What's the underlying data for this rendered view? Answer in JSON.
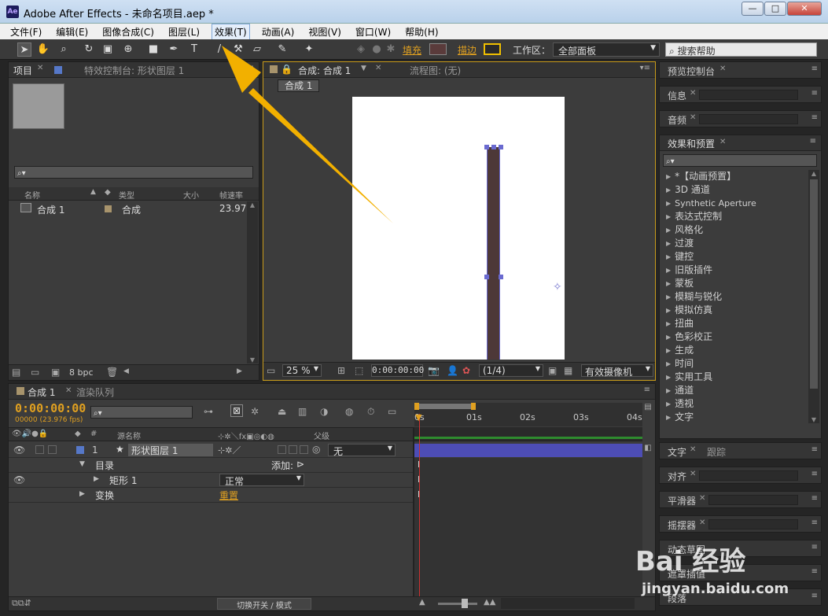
{
  "window": {
    "title": "Adobe After Effects - 未命名项目.aep *",
    "logo": "Ae",
    "min": "—",
    "max": "□",
    "close": "✕"
  },
  "menu": [
    "文件(F)",
    "编辑(E)",
    "图像合成(C)",
    "图层(L)",
    "效果(T)",
    "动画(A)",
    "视图(V)",
    "窗口(W)",
    "帮助(H)"
  ],
  "toolbar": {
    "fill_label": "填充",
    "stroke_label": "描边",
    "workspace_label": "工作区：",
    "workspace_value": "全部面板",
    "search_placeholder": "搜索帮助",
    "fill_color": "#5a3b3b",
    "stroke_color": "#f0c000"
  },
  "project_panel": {
    "tab_project": "项目",
    "tab_effects_control": "特效控制台: 形状图层 1",
    "columns": [
      "名称",
      "类型",
      "大小",
      "帧速率"
    ],
    "items": [
      {
        "name": "合成 1",
        "type": "合成",
        "fps": "23.976"
      }
    ],
    "bpc": "8 bpc"
  },
  "composition_panel": {
    "tab_comp": "合成: 合成 1",
    "tab_flow": "流程图: (无)",
    "breadcrumb": "合成 1",
    "zoom": "25 %",
    "timecode": "0:00:00:00",
    "resolution": "(1/4)",
    "camera": "有效摄像机",
    "bar_color": "#4d3838"
  },
  "right_panels": {
    "preview": "预览控制台",
    "info": "信息",
    "audio": "音频",
    "effects_presets": "效果和预置",
    "effects_list": [
      "*【动画预置】",
      "3D 通道",
      "Synthetic Aperture",
      "表达式控制",
      "风格化",
      "过渡",
      "键控",
      "旧版插件",
      "蒙板",
      "模糊与锐化",
      "模拟仿真",
      "扭曲",
      "色彩校正",
      "生成",
      "时间",
      "实用工具",
      "通道",
      "透视",
      "文字"
    ],
    "bottom": [
      {
        "label": "文字",
        "extra": "跟踪"
      },
      {
        "label": "对齐"
      },
      {
        "label": "平滑器"
      },
      {
        "label": "摇摆器"
      },
      {
        "label": "动态草图"
      },
      {
        "label": "遮罩插值"
      },
      {
        "label": "段落"
      }
    ]
  },
  "timeline": {
    "tab_comp": "合成 1",
    "tab_render": "渲染队列",
    "timecode": "0:00:00:00",
    "fps_info": "00000 (23.976 fps)",
    "col_source": "源名称",
    "col_parent": "父级",
    "layer_num": "1",
    "layer_name": "形状图层 1",
    "parent_value": "无",
    "contents_label": "目录",
    "add_label": "添加:",
    "rect_label": "矩形 1",
    "blend_mode": "正常",
    "transform_label": "变换",
    "reset_label": "重置",
    "ruler": [
      "0s",
      "01s",
      "02s",
      "03s",
      "04s"
    ],
    "footer_toggle": "切换开关 / 模式"
  },
  "watermark": {
    "brand": "Bai 经验",
    "url": "jingyan.baidu.com"
  }
}
